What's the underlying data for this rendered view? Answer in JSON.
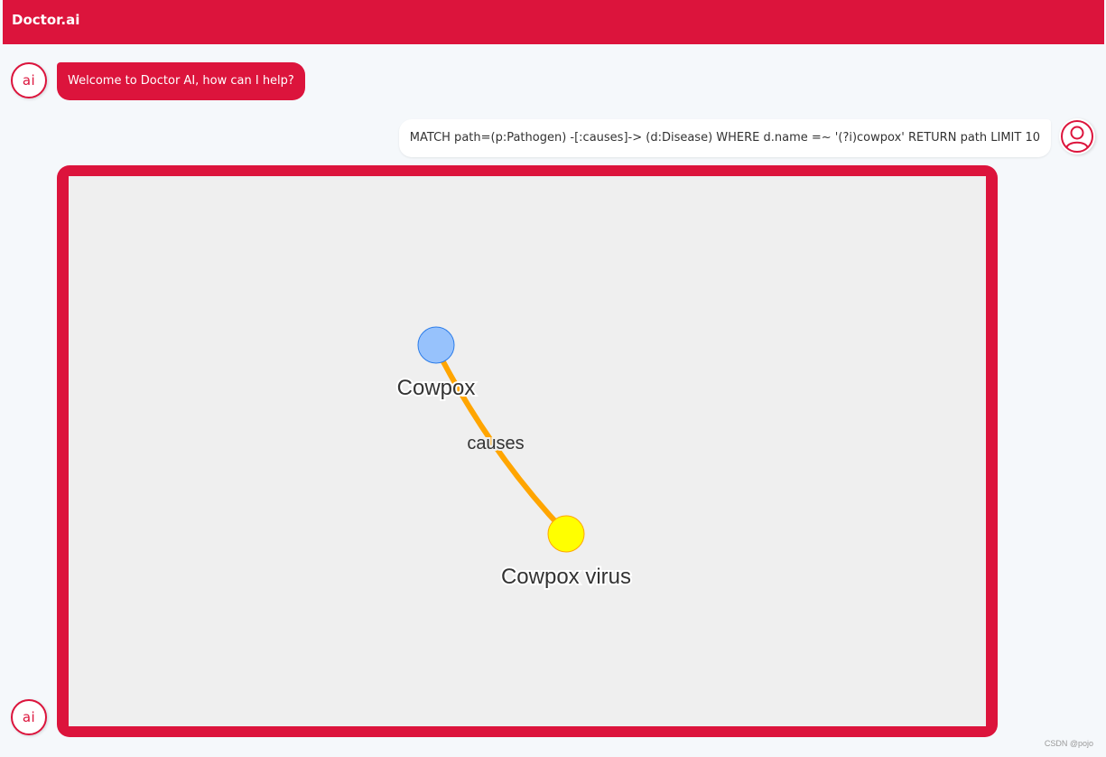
{
  "header": {
    "title": "Doctor.ai"
  },
  "chat": {
    "bot_avatar_label": "ai",
    "bot_message_1": "Welcome to Doctor AI, how can I help?",
    "user_message_1": "MATCH path=(p:Pathogen) -[:causes]-> (d:Disease) WHERE d.name =~ '(?i)cowpox' RETURN path LIMIT 10",
    "user_avatar_icon": "user-icon"
  },
  "graph": {
    "nodes": [
      {
        "label": "Cowpox",
        "fill": "#97c2fc",
        "stroke": "#2b7ce9"
      },
      {
        "label": "Cowpox virus",
        "fill": "#ffff00",
        "stroke": "#ffa500"
      }
    ],
    "edge": {
      "label": "causes",
      "color": "#ffa500"
    }
  },
  "colors": {
    "accent": "#dc143c",
    "background": "#f5f8fb",
    "canvas": "#efefef"
  },
  "watermark": "CSDN @pojo"
}
